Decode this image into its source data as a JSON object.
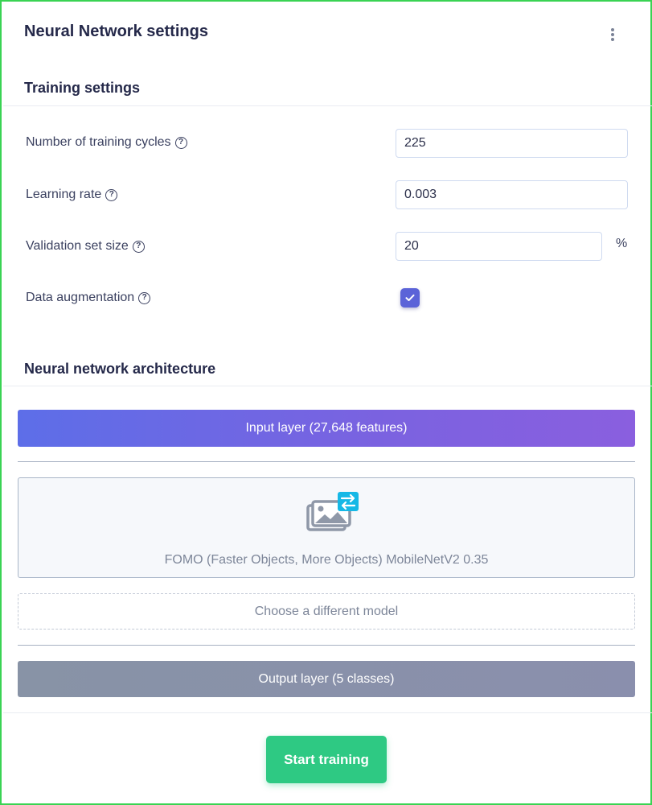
{
  "panel": {
    "title": "Neural Network settings",
    "menu_icon": "kebab-menu-icon"
  },
  "training": {
    "title": "Training settings",
    "cycles": {
      "label": "Number of training cycles",
      "value": "225"
    },
    "learning_rate": {
      "label": "Learning rate",
      "value": "0.003"
    },
    "validation": {
      "label": "Validation set size",
      "value": "20",
      "unit": "%"
    },
    "augmentation": {
      "label": "Data augmentation",
      "checked": true
    },
    "help_icon": "?"
  },
  "architecture": {
    "title": "Neural network architecture",
    "input_layer": "Input layer (27,648 features)",
    "model_name": "FOMO (Faster Objects, More Objects) MobileNetV2 0.35",
    "model_icon": "images-swap-icon",
    "choose_model": "Choose a different model",
    "output_layer": "Output layer (5 classes)"
  },
  "actions": {
    "start_training": "Start training"
  },
  "colors": {
    "accent_purple": "#5b63d8",
    "start_green": "#2ec983",
    "border_green": "#39d353"
  }
}
